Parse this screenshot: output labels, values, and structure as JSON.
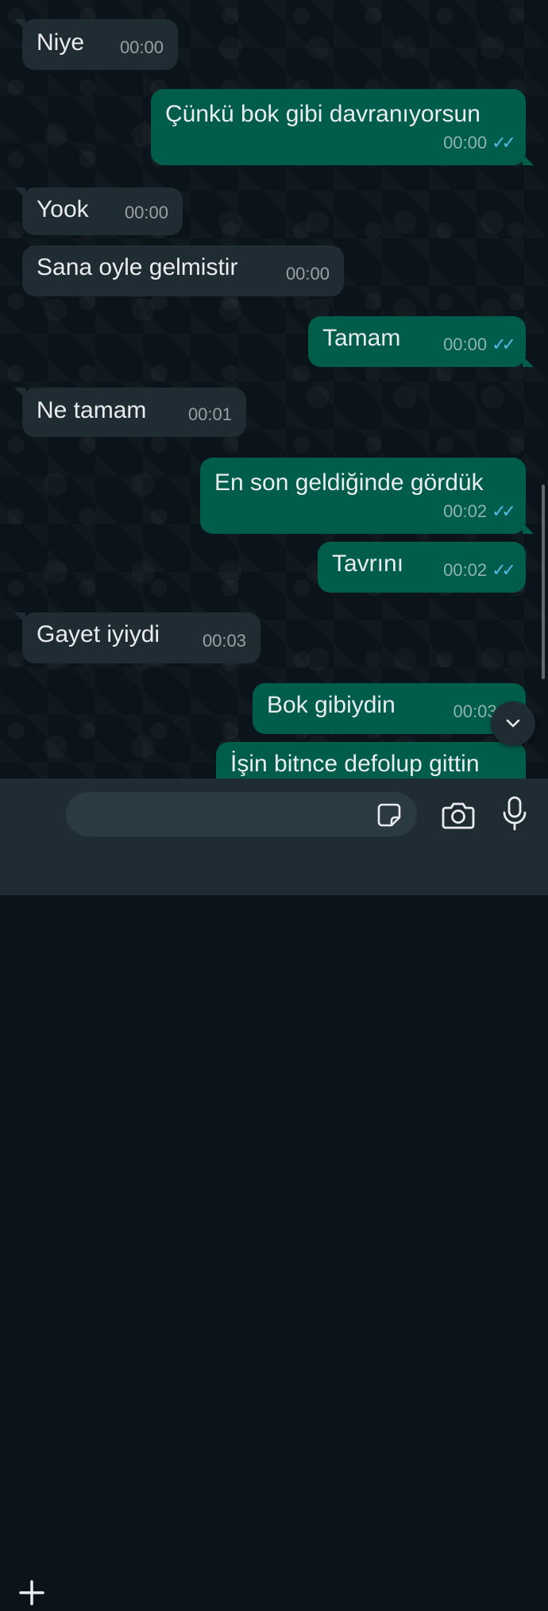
{
  "messages": [
    {
      "dir": "in",
      "text": "Niye",
      "time": "00:00"
    },
    {
      "dir": "out",
      "text": "Çünkü bok gibi davranıyorsun",
      "time": "00:00",
      "ticks": "✓✓"
    },
    {
      "dir": "in",
      "text": "Yook",
      "time": "00:00"
    },
    {
      "dir": "in",
      "text": "Sana oyle gelmistir",
      "time": "00:00"
    },
    {
      "dir": "out",
      "text": "Tamam",
      "time": "00:00",
      "ticks": "✓✓"
    },
    {
      "dir": "in",
      "text": "Ne tamam",
      "time": "00:01"
    },
    {
      "dir": "out",
      "text": "En son geldiğinde gördük",
      "time": "00:02",
      "ticks": "✓✓"
    },
    {
      "dir": "out",
      "text": "Tavrını",
      "time": "00:02",
      "ticks": "✓✓"
    },
    {
      "dir": "in",
      "text": "Gayet iyiydi",
      "time": "00:03"
    },
    {
      "dir": "out",
      "text": "Bok gibiydin",
      "time": "00:03",
      "ticks": "✓"
    },
    {
      "dir": "out",
      "text": "İşin bitnce defolup gittin",
      "time": "",
      "ticks": ""
    }
  ],
  "composer": {
    "input_value": "",
    "attach_icon": "plus-icon",
    "sticker_icon": "sticker-icon",
    "camera_icon": "camera-icon",
    "mic_icon": "microphone-icon"
  },
  "colors": {
    "incoming": "#202c33",
    "outgoing": "#005c4b",
    "read_ticks": "#53bdeb"
  }
}
